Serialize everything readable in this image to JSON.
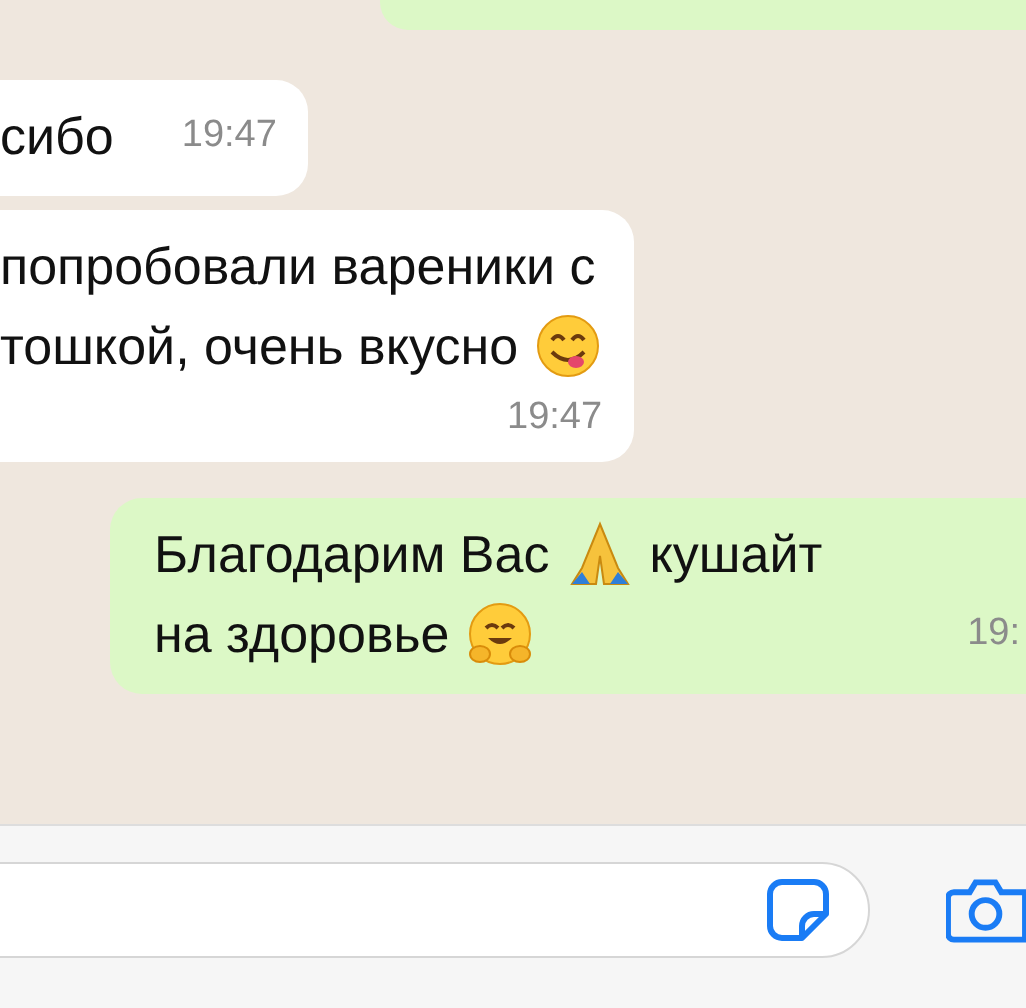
{
  "messages": [
    {
      "kind": "outgoing"
    },
    {
      "kind": "incoming",
      "time_below": false,
      "lines": [
        [
          {
            "kind": "text",
            "text": "сибо"
          }
        ]
      ],
      "time": "19:47"
    },
    {
      "kind": "incoming",
      "time_below": true,
      "lines": [
        [
          {
            "kind": "text",
            "text": "попробовали вареники с"
          }
        ],
        [
          {
            "kind": "text",
            "text": "тошкой, очень вкусно"
          },
          {
            "kind": "savoring-face"
          }
        ]
      ],
      "time": "19:47"
    },
    {
      "kind": "outgoing",
      "time_below": false,
      "lines": [
        [
          {
            "kind": "text",
            "text": "Благодарим Вас"
          },
          {
            "kind": "folded-hands"
          },
          {
            "kind": "text",
            "text": "кушайт"
          }
        ],
        [
          {
            "kind": "text",
            "text": "на здоровье"
          },
          {
            "kind": "hugging-face"
          }
        ]
      ],
      "time": "19:"
    }
  ]
}
